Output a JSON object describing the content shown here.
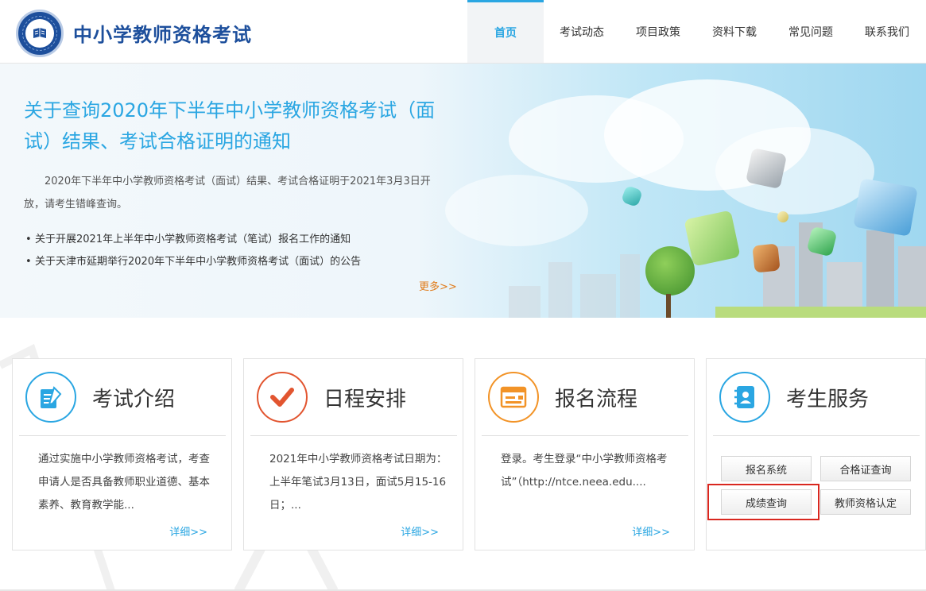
{
  "header": {
    "site_title": "中小学教师资格考试",
    "nav": [
      {
        "label": "首页",
        "active": true
      },
      {
        "label": "考试动态",
        "active": false
      },
      {
        "label": "项目政策",
        "active": false
      },
      {
        "label": "资料下载",
        "active": false
      },
      {
        "label": "常见问题",
        "active": false
      },
      {
        "label": "联系我们",
        "active": false
      }
    ]
  },
  "banner": {
    "title": "关于查询2020年下半年中小学教师资格考试（面试）结果、考试合格证明的通知",
    "desc": "2020年下半年中小学教师资格考试（面试）结果、考试合格证明于2021年3月3日开放，请考生错峰查询。",
    "news": [
      "关于开展2021年上半年中小学教师资格考试（笔试）报名工作的通知",
      "关于天津市延期举行2020年下半年中小学教师资格考试（面试）的公告"
    ],
    "more": "更多>>"
  },
  "cards": [
    {
      "title": "考试介绍",
      "text": "通过实施中小学教师资格考试，考查申请人是否具备教师职业道德、基本素养、教育教学能...",
      "link": "详细>>",
      "icon": "pen-document-icon"
    },
    {
      "title": "日程安排",
      "text": "2021年中小学教师资格考试日期为：上半年笔试3月13日，面试5月15-16日；...",
      "link": "详细>>",
      "icon": "checkmark-icon"
    },
    {
      "title": "报名流程",
      "text": "登录。考生登录“中小学教师资格考试”（http://ntce.neea.edu....",
      "link": "详细>>",
      "icon": "browser-form-icon"
    },
    {
      "title": "考生服务",
      "icon": "contact-book-icon"
    }
  ],
  "services": {
    "registration": "报名系统",
    "certificate_query": "合格证查询",
    "score_query": "成绩查询",
    "qualification": "教师资格认定"
  },
  "colors": {
    "brand_blue": "#1d4f9c",
    "accent_blue": "#2aa6e2",
    "accent_red": "#e25530",
    "accent_orange": "#f29327",
    "highlight_red": "#d9271f"
  }
}
